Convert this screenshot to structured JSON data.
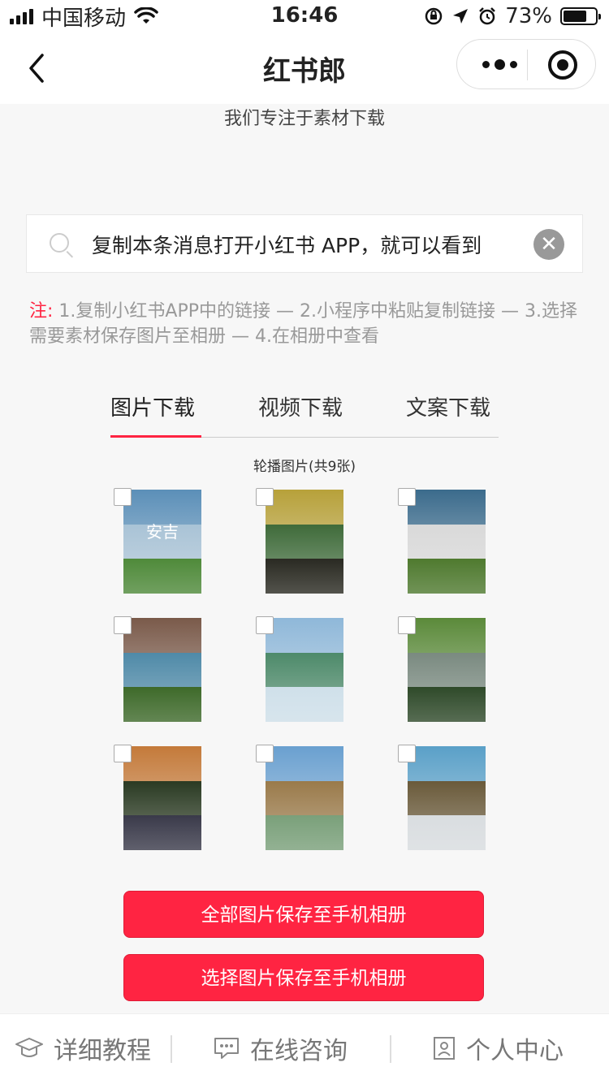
{
  "status_bar": {
    "carrier": "中国移动",
    "time": "16:46",
    "battery_percent": "73%",
    "battery_level": 0.73,
    "icons": [
      "signal-icon",
      "wifi-icon",
      "rotation-lock-icon",
      "location-icon",
      "alarm-icon",
      "battery-icon"
    ]
  },
  "nav": {
    "title": "红书郎",
    "back_icon": "chevron-left-icon",
    "more_icon": "more-dots-icon",
    "close_icon": "target-icon"
  },
  "subtitle": "我们专注于素材下载",
  "search": {
    "value": "复制本条消息打开小红书 APP，就可以看到",
    "placeholder": ""
  },
  "notice": {
    "label": "注:",
    "text": " 1.复制小红书APP中的链接 — 2.小程序中粘贴复制链接 — 3.选择需要素材保存图片至相册 — 4.在相册中查看"
  },
  "tabs": [
    "图片下载",
    "视频下载",
    "文案下载"
  ],
  "active_tab": 0,
  "image_count": "轮播图片(共9张)",
  "image_overlay_text": "安吉",
  "images": [
    {
      "colors": [
        "#5b8fb8",
        "#a9c3d6",
        "#4f8a3a"
      ]
    },
    {
      "colors": [
        "#b7a13a",
        "#3f6b3a",
        "#2a2a22"
      ]
    },
    {
      "colors": [
        "#3b6b8c",
        "#d9d9d9",
        "#4f7a2f"
      ]
    },
    {
      "colors": [
        "#7a5a4a",
        "#4f8aa8",
        "#3e6a2a"
      ]
    },
    {
      "colors": [
        "#8fb8d9",
        "#4d8a6a",
        "#cfe0ea"
      ]
    },
    {
      "colors": [
        "#5b8a3a",
        "#7a8a80",
        "#2f4a2a"
      ]
    },
    {
      "colors": [
        "#c47a3a",
        "#2a3a22",
        "#3a3a4a"
      ]
    },
    {
      "colors": [
        "#6aa0d0",
        "#9a7a4a",
        "#7aa07a"
      ]
    },
    {
      "colors": [
        "#5aa0c8",
        "#6a5a3a",
        "#d9dde0"
      ]
    }
  ],
  "buttons": {
    "save_all": "全部图片保存至手机相册",
    "save_selected": "选择图片保存至手机相册"
  },
  "bottom_bar": [
    {
      "label": "详细教程",
      "icon": "graduation-cap-icon"
    },
    {
      "label": "在线咨询",
      "icon": "chat-bubble-icon"
    },
    {
      "label": "个人中心",
      "icon": "profile-card-icon"
    }
  ],
  "colors": {
    "accent": "#ff2442",
    "muted_text": "#999999"
  }
}
